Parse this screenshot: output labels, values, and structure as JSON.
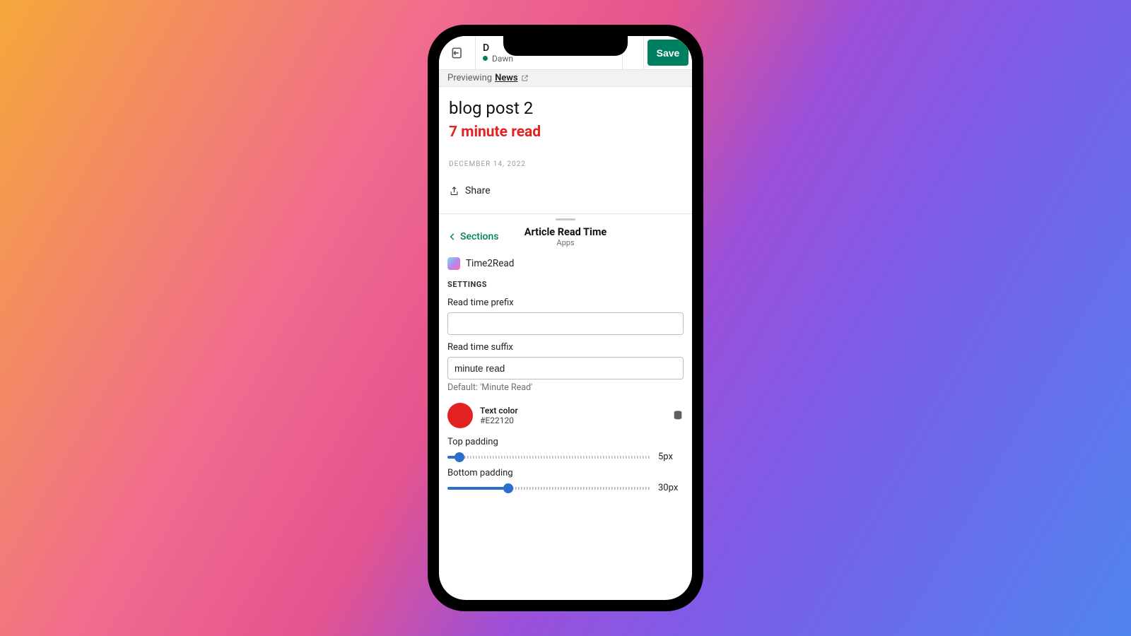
{
  "topbar": {
    "theme_name": "Dawn",
    "title_initial": "D",
    "save_label": "Save"
  },
  "preview_strip": {
    "previewing_label": "Previewing",
    "page_name": "News"
  },
  "article": {
    "title": "blog post 2",
    "read_time_display": "7 minute read",
    "date": "DECEMBER 14, 2022",
    "share_label": "Share"
  },
  "panel": {
    "back_label": "Sections",
    "title": "Article Read Time",
    "subtitle": "Apps",
    "app_name": "Time2Read",
    "settings_heading": "SETTINGS",
    "fields": {
      "prefix": {
        "label": "Read time prefix",
        "value": ""
      },
      "suffix": {
        "label": "Read time suffix",
        "value": "minute read",
        "helper": "Default: 'Minute Read'"
      },
      "text_color": {
        "label": "Text color",
        "hex": "#E22120"
      },
      "top_padding": {
        "label": "Top padding",
        "value_display": "5px",
        "value": 5,
        "max": 100,
        "fill_pct": 6
      },
      "bottom_padding": {
        "label": "Bottom padding",
        "value_display": "30px",
        "value": 30,
        "max": 100,
        "fill_pct": 30
      }
    }
  }
}
